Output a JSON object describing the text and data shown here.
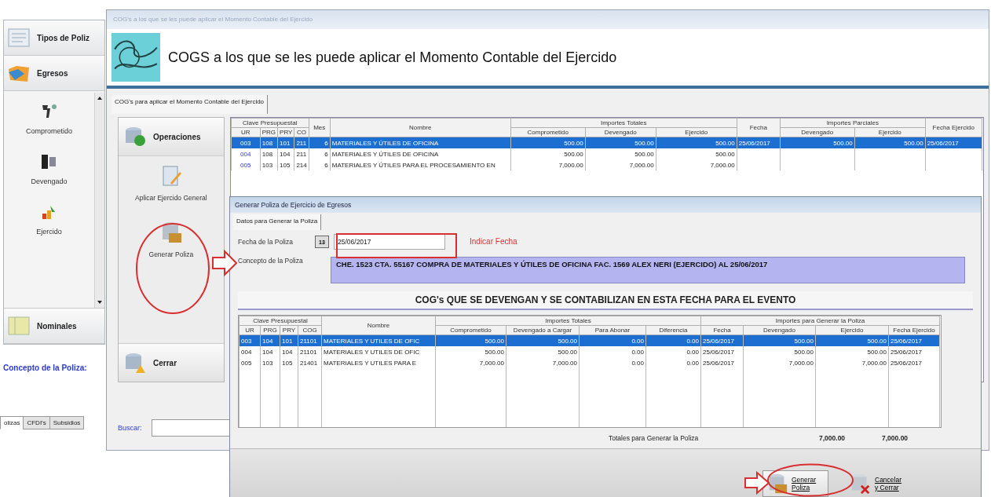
{
  "nav": {
    "headers_top": [
      "Tipos de Poliz",
      "Egresos"
    ],
    "items": [
      "Comprometido",
      "Devengado",
      "Ejercido"
    ],
    "header_bottom": "Nominales"
  },
  "concept_label": "Concepto de la Poliza:",
  "bottom_tabs": [
    {
      "label": "olizas",
      "selected": true
    },
    {
      "label": "CFDI's",
      "selected": false
    },
    {
      "label": "Subsidios",
      "selected": false
    }
  ],
  "main_window": {
    "title": "COG's a los que se les puede aplicar el Momento Contable del Ejercido",
    "heading": "COGS a los que se les puede aplicar el Momento Contable del Ejercido",
    "tab": "COG's para aplicar el Momento Contable del Ejercido",
    "operations": {
      "header": "Operaciones",
      "actions": [
        "Aplicar Ejercido General",
        "Generar Poliza"
      ],
      "footer": "Cerrar"
    },
    "table": {
      "header": [
        {
          "label": "Clave Presupuestal",
          "columns": [
            "UR",
            "PRG",
            "PRY",
            "CO"
          ]
        },
        {
          "label": "Mes"
        },
        {
          "label": "Nombre"
        },
        {
          "label": "Importes Totales",
          "columns": [
            "Comprometido",
            "Devengado",
            "Ejercido"
          ]
        },
        {
          "label": "Fecha"
        },
        {
          "label": "Importes Parciales",
          "columns": [
            "Devengado",
            "Ejercido"
          ]
        },
        {
          "label": "Fecha Ejercido"
        }
      ],
      "rows": [
        {
          "selected": true,
          "cells": [
            "003",
            "108",
            "101",
            "211",
            "6",
            "MATERIALES Y ÚTILES DE OFICINA",
            "500.00",
            "500.00",
            "500.00",
            "25/06/2017",
            "500.00",
            "500.00",
            "25/06/2017"
          ]
        },
        {
          "selected": false,
          "cells": [
            "004",
            "108",
            "104",
            "211",
            "6",
            "MATERIALES Y ÚTILES DE OFICINA",
            "500.00",
            "500.00",
            "500.00"
          ]
        },
        {
          "selected": false,
          "cells": [
            "005",
            "103",
            "105",
            "214",
            "6",
            "MATERIALES Y ÚTILES PARA EL PROCESAMIENTO EN",
            "7,000.00",
            "7,000.00",
            "7,000.00"
          ]
        }
      ]
    },
    "search_label": "Buscar:"
  },
  "dialog": {
    "title": "Generar Poliza de Ejercicio de Egresos",
    "tab": "Datos para Generar la Poliza",
    "date_label": "Fecha de la Poliza",
    "calendar_button": "13",
    "date_value": "25/06/2017",
    "concept_label": "Concepto de la Poliza",
    "concept_value": "CHE. 1523 CTA. 55167 COMPRA DE MATERIALES Y ÚTILES DE OFICINA FAC. 1569 ALEX NERI (EJERCIDO) AL 25/06/2017",
    "section_heading": "COG's QUE SE DEVENGAN Y SE CONTABILIZAN EN ESTA FECHA PARA EL EVENTO",
    "table": {
      "header": [
        {
          "label": "Clave Presupuestal",
          "columns": [
            "UR",
            "PRG",
            "PRY",
            "COG"
          ]
        },
        {
          "label": "Nombre"
        },
        {
          "label": "Importes Totales",
          "columns": [
            "Comprometido",
            "Devengado a Cargar",
            "Para Abonar",
            "Diferencia"
          ]
        },
        {
          "label": "Importes para Generar la Poliza",
          "columns": [
            "Fecha",
            "Devengado",
            "Ejercido",
            "Fecha Ejercido"
          ]
        }
      ],
      "rows": [
        {
          "selected": true,
          "cells": [
            "003",
            "104",
            "101",
            "21101",
            "MATERIALES Y UTILES DE OFIC",
            "500.00",
            "500.00",
            "0.00",
            "0.00",
            "25/06/2017",
            "500.00",
            "500.00",
            "25/06/2017"
          ]
        },
        {
          "selected": false,
          "cells": [
            "004",
            "104",
            "104",
            "21101",
            "MATERIALES Y UTILES DE OFIC",
            "500.00",
            "500.00",
            "0.00",
            "0.00",
            "25/06/2017",
            "500.00",
            "500.00",
            "25/06/2017"
          ]
        },
        {
          "selected": false,
          "cells": [
            "005",
            "103",
            "105",
            "21401",
            "MATERIALES Y UTILES PARA E",
            "7,000.00",
            "7,000.00",
            "0.00",
            "0.00",
            "25/06/2017",
            "7,000.00",
            "7,000.00",
            "25/06/2017"
          ]
        }
      ]
    },
    "totals_label": "Totales para Generar la Poliza",
    "totals": [
      "7,000.00",
      "7,000.00"
    ],
    "buttons": [
      {
        "label": "Generar Poliza",
        "kind": "generate"
      },
      {
        "label": "Cancelar y Cerrar",
        "kind": "cancel"
      }
    ]
  },
  "annotations": {
    "date_hint": "Indicar Fecha"
  }
}
